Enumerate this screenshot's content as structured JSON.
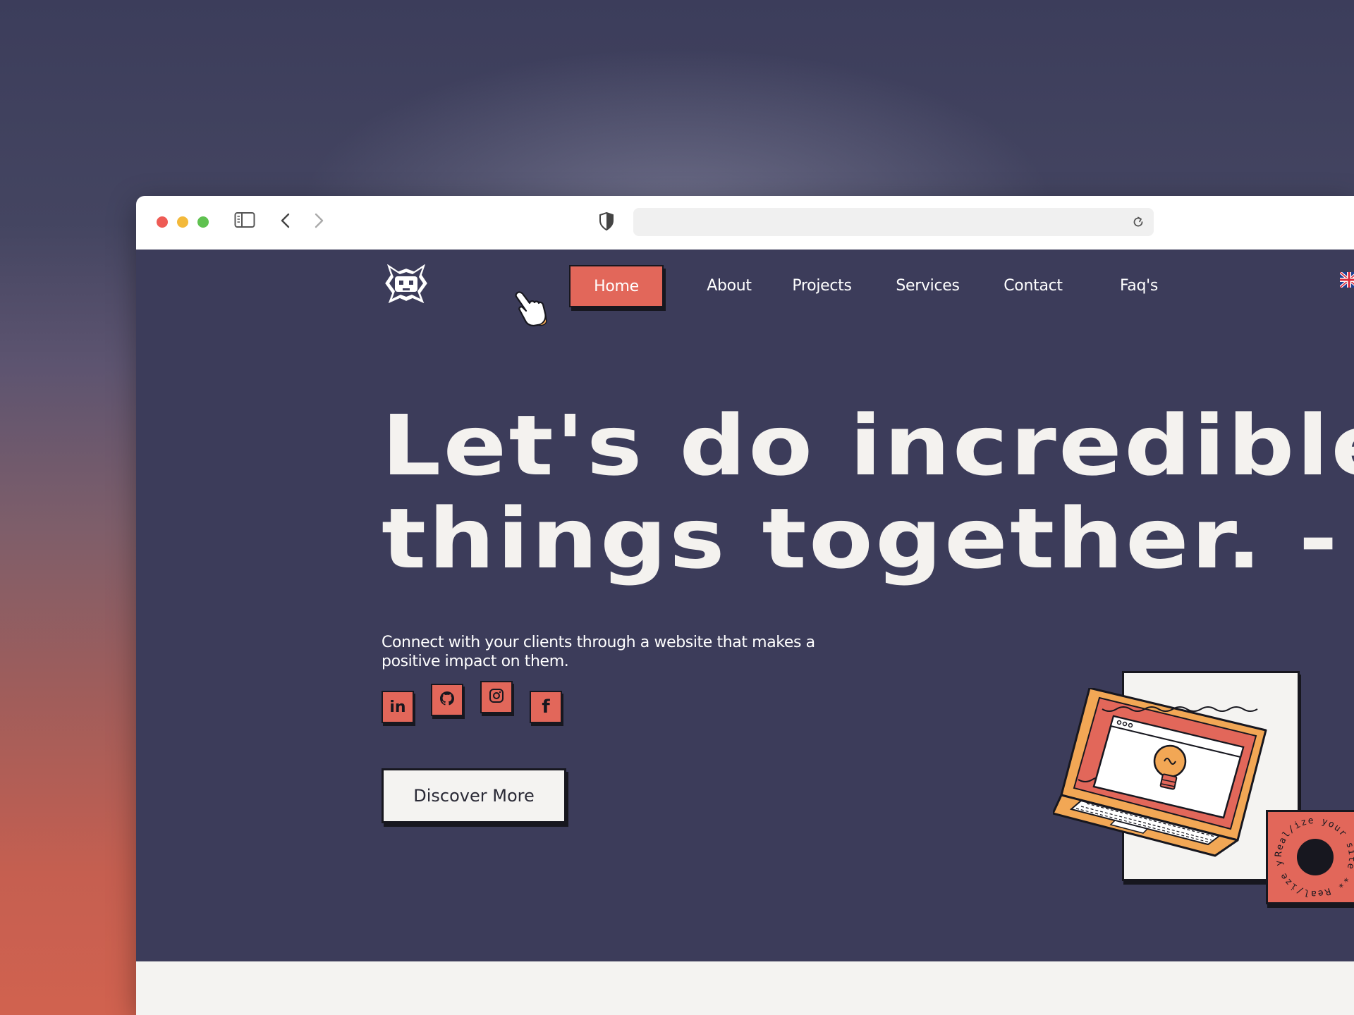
{
  "browser": {
    "traffic_lights": [
      "#ee5b55",
      "#f3b93a",
      "#5fc150"
    ],
    "address_value": ""
  },
  "site": {
    "nav": {
      "items": [
        {
          "label": "Home",
          "active": true
        },
        {
          "label": "About",
          "active": false
        },
        {
          "label": "Projects",
          "active": false
        },
        {
          "label": "Services",
          "active": false
        },
        {
          "label": "Contact",
          "active": false
        },
        {
          "label": "Faq's",
          "active": false
        }
      ],
      "language_icon": "uk-flag-icon"
    },
    "hero": {
      "title_line1": "Let's do incredible",
      "title_line2": "things together. -",
      "subtitle": "Connect with your clients through a website that makes a positive impact on them.",
      "social": [
        {
          "icon": "linkedin-icon",
          "glyph": "in"
        },
        {
          "icon": "github-icon"
        },
        {
          "icon": "instagram-icon"
        },
        {
          "icon": "facebook-icon",
          "glyph": "f"
        }
      ],
      "cta_label": "Discover More",
      "badge_text": "Real/ize your site ** Real/ize your site **"
    }
  },
  "colors": {
    "page_bg": "#3c3c5a",
    "accent": "#e2675a",
    "ink": "#17171f",
    "paper": "#f4f3f1"
  }
}
